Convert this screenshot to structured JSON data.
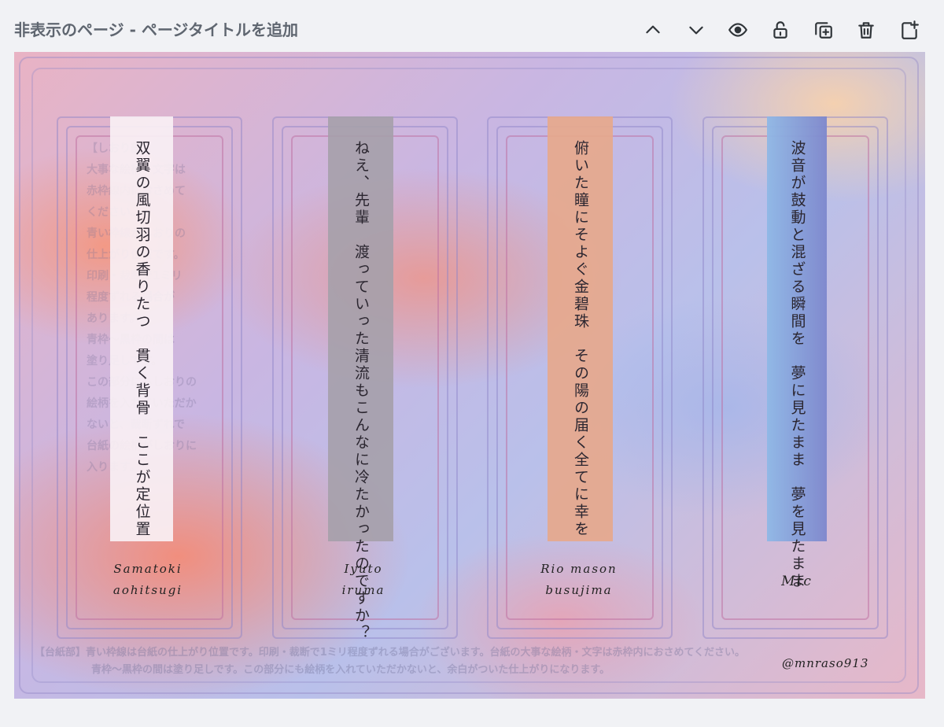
{
  "header": {
    "title": "非表示のページ - ページタイトルを追加",
    "tools": [
      {
        "icon": "chevron-up-icon"
      },
      {
        "icon": "chevron-down-icon"
      },
      {
        "icon": "eye-icon"
      },
      {
        "icon": "unlock-icon"
      },
      {
        "icon": "duplicate-page-icon"
      },
      {
        "icon": "trash-icon"
      },
      {
        "icon": "add-page-icon"
      }
    ]
  },
  "design": {
    "colors": {
      "strip_1": "#f6eef2",
      "strip_2": "#a8a3ad",
      "strip_3": "#e6a88c",
      "strip_4_top": "#8fb8e6",
      "strip_4_bottom": "#8b8fd4"
    },
    "guide_text_lines": [
      "【しおり部】",
      "大事な絵柄・文字は",
      "赤枠線内におさめて",
      "ください。",
      "青い枠線がしおりの",
      "仕上がり位置です。",
      "印刷・裁断で1ミリ",
      "程度ずれる場合が",
      "あります。",
      "青枠〜黒枠の間は",
      "塗り足しです。",
      "この部分にもしおりの",
      "絵柄を入れていただか",
      "ないと、裁断ずれで",
      "台紙の絵柄がしおりに",
      "入ります。"
    ],
    "cards": [
      {
        "poem": "双翼の風切羽の香りたつ　貫く背骨　ここが定位置",
        "sig_line1": "Samatoki",
        "sig_line2": "aohitsugi"
      },
      {
        "poem": "ねえ、先輩　渡っていった清流もこんなに冷たかったのですか？",
        "sig_line1": "Iyuto",
        "sig_line2": "iruma"
      },
      {
        "poem": "俯いた瞳にそよぐ金碧珠　その陽の届く全てに幸を",
        "sig_line1": "Rio mason",
        "sig_line2": "busujima"
      },
      {
        "poem": "波音が鼓動と混ざる瞬間を　夢に見たまま　夢を見たまま",
        "sig_line1": "Mtc",
        "sig_line2": ""
      }
    ],
    "footer_line1": "【台紙部】青い枠線は台紙の仕上がり位置です。印刷・裁断で1ミリ程度ずれる場合がございます。台紙の大事な絵柄・文字は赤枠内におさめてください。",
    "footer_line2": "青枠〜黒枠の間は塗り足しです。この部分にも絵柄を入れていただかないと、余白がついた仕上がりになります。",
    "credit": "@mnraso913"
  }
}
